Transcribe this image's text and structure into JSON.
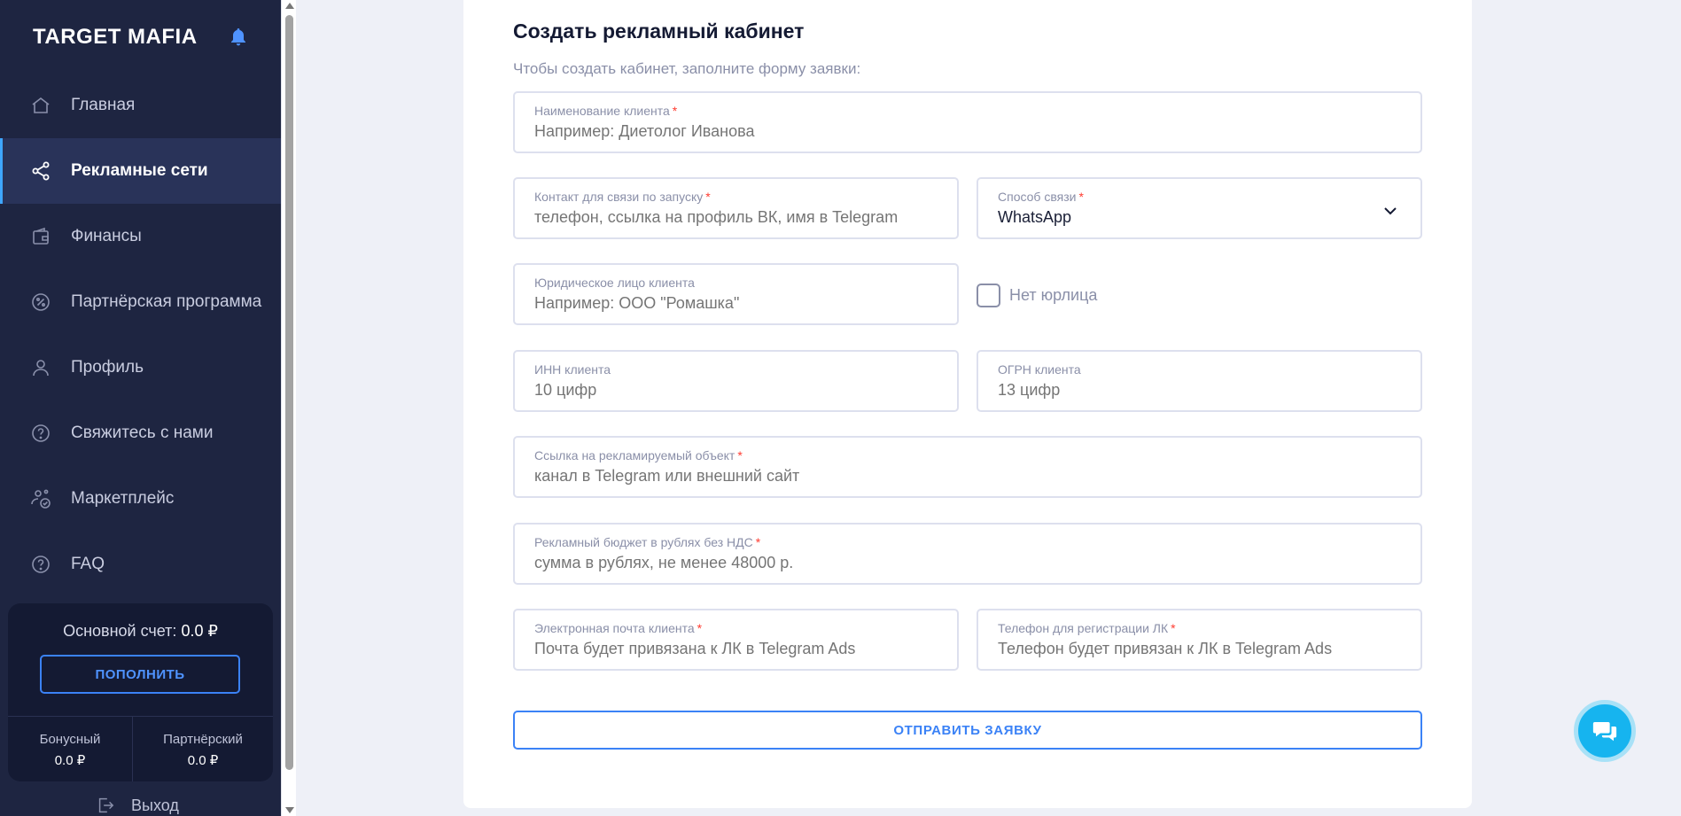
{
  "sidebar": {
    "brand": "TARGET MAFIA",
    "items": [
      {
        "label": "Главная",
        "icon": "home-icon"
      },
      {
        "label": "Рекламные сети",
        "icon": "share-icon",
        "active": true
      },
      {
        "label": "Финансы",
        "icon": "wallet-icon"
      },
      {
        "label": "Партнёрская программа",
        "icon": "percent-icon"
      },
      {
        "label": "Профиль",
        "icon": "user-icon"
      },
      {
        "label": "Свяжитесь с нами",
        "icon": "help-icon"
      },
      {
        "label": "Маркетплейс",
        "icon": "users-check-icon"
      },
      {
        "label": "FAQ",
        "icon": "question-icon"
      }
    ],
    "balance": {
      "main_label": "Основной счет:",
      "main_value": "0.0 ₽",
      "topup_label": "ПОПОЛНИТЬ",
      "bonus_label": "Бонусный",
      "bonus_value": "0.0 ₽",
      "partner_label": "Партнёрский",
      "partner_value": "0.0 ₽"
    },
    "logout_label": "Выход"
  },
  "form": {
    "title": "Создать рекламный кабинет",
    "subtitle": "Чтобы создать кабинет, заполните форму заявки:",
    "client_name": {
      "label": "Наименование клиента",
      "required": "*",
      "placeholder": "Например: Диетолог Иванова"
    },
    "contact": {
      "label": "Контакт для связи по запуску",
      "required": "*",
      "placeholder": "телефон, ссылка на профиль ВК, имя в Telegram"
    },
    "contact_method": {
      "label": "Способ связи",
      "required": "*",
      "value": "WhatsApp"
    },
    "legal_entity": {
      "label": "Юридическое лицо клиента",
      "placeholder": "Например: ООО \"Ромашка\""
    },
    "no_legal_entity": {
      "label": "Нет юрлица",
      "checked": false
    },
    "inn": {
      "label": "ИНН клиента",
      "placeholder": "10 цифр"
    },
    "ogrn": {
      "label": "ОГРН клиента",
      "placeholder": "13 цифр"
    },
    "ad_link": {
      "label": "Ссылка на рекламируемый объект",
      "required": "*",
      "placeholder": "канал в Telegram или внешний сайт"
    },
    "budget": {
      "label": "Рекламный бюджет в рублях без НДС",
      "required": "*",
      "placeholder": "сумма в рублях, не менее 48000 р."
    },
    "email": {
      "label": "Электронная почта клиента",
      "required": "*",
      "placeholder": "Почта будет привязана к ЛК в Telegram Ads"
    },
    "phone": {
      "label": "Телефон для регистрации ЛК",
      "required": "*",
      "placeholder": "Телефон будет привязан к ЛК в Telegram Ads"
    },
    "submit_label": "ОТПРАВИТЬ ЗАЯВКУ"
  },
  "colors": {
    "sidebar_bg": "#1e2541",
    "accent": "#3b82f6",
    "active_bar": "#3ea6ff",
    "chat": "#16b4ef",
    "required": "#ff3b30"
  }
}
